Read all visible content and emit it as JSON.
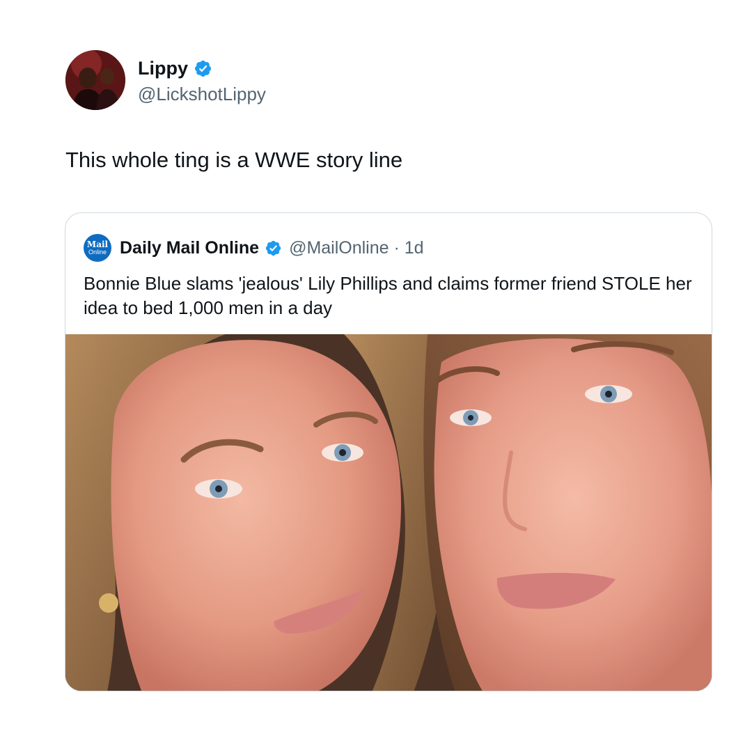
{
  "tweet": {
    "author": {
      "name": "Lippy",
      "handle": "@LickshotLippy",
      "verified": true,
      "avatar_icon": "profile-photo"
    },
    "text": "This whole ting is a WWE story line"
  },
  "quoted_tweet": {
    "logo": {
      "line1": "Mail",
      "line2": "Online"
    },
    "author": {
      "name": "Daily Mail Online",
      "handle": "@MailOnline",
      "verified": true
    },
    "meta_separator": " · ",
    "time": "1d",
    "text": "Bonnie Blue slams 'jealous' Lily Phillips and claims former friend STOLE her idea to bed 1,000 men in a day",
    "media": {
      "type": "photo",
      "icon": "photo-two-women-selfie"
    }
  },
  "colors": {
    "verified_badge": "#1d9bf0",
    "logo_background": "#0e6bc0",
    "secondary_text": "#536471",
    "card_border": "#cfd9de"
  }
}
